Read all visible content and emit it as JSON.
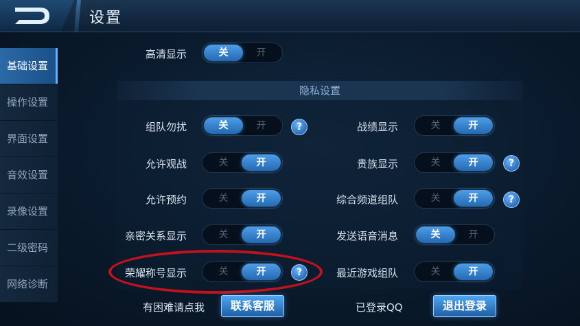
{
  "header": {
    "title": "设置"
  },
  "sidebar": {
    "items": [
      {
        "label": "基础设置",
        "active": true
      },
      {
        "label": "操作设置",
        "active": false
      },
      {
        "label": "界面设置",
        "active": false
      },
      {
        "label": "音效设置",
        "active": false
      },
      {
        "label": "录像设置",
        "active": false
      },
      {
        "label": "二级密码",
        "active": false
      },
      {
        "label": "网络诊断",
        "active": false
      }
    ]
  },
  "toggle_labels": {
    "off": "关",
    "on": "开"
  },
  "hd_display": {
    "label": "高清显示",
    "state": "off"
  },
  "privacy": {
    "title": "隐私设置",
    "left": [
      {
        "label": "组队勿扰",
        "state": "off",
        "help": true
      },
      {
        "label": "允许观战",
        "state": "on",
        "help": false
      },
      {
        "label": "允许预约",
        "state": "on",
        "help": false
      },
      {
        "label": "亲密关系显示",
        "state": "on",
        "help": false
      },
      {
        "label": "荣耀称号显示",
        "state": "on",
        "help": true
      }
    ],
    "right": [
      {
        "label": "战绩显示",
        "state": "on",
        "help": false
      },
      {
        "label": "贵族显示",
        "state": "on",
        "help": true
      },
      {
        "label": "综合频道组队",
        "state": "on",
        "help": true
      },
      {
        "label": "发送语音消息",
        "state": "off",
        "help": false
      },
      {
        "label": "最近游戏组队",
        "state": "on",
        "help": false
      }
    ]
  },
  "footer": {
    "help_text": "有困难请点我",
    "contact_button": "联系客服",
    "login_text": "已登录QQ",
    "logout_button": "退出登录"
  },
  "help_glyph": "?"
}
